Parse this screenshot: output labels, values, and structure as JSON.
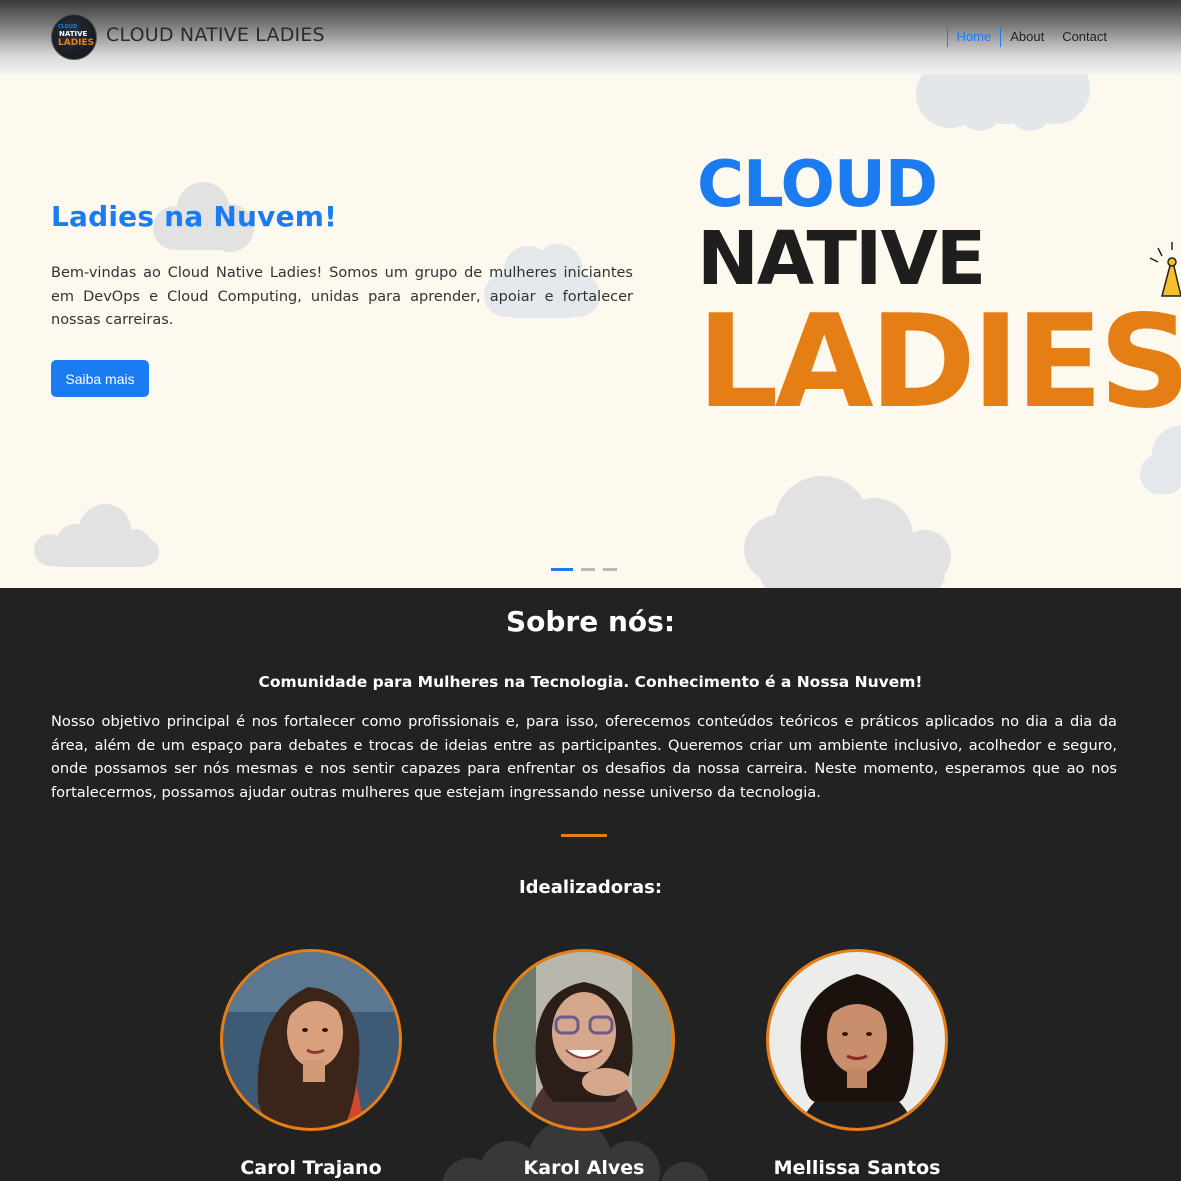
{
  "navbar": {
    "brand_name": "CLOUD NATIVE LADIES",
    "logo_text": [
      "CLOUD",
      "NATIVE",
      "LADIES"
    ],
    "links": [
      {
        "label": "Home",
        "active": true
      },
      {
        "label": "About",
        "active": false
      },
      {
        "label": "Contact",
        "active": false
      }
    ]
  },
  "hero": {
    "title": "Ladies na Nuvem!",
    "text": "Bem-vindas ao Cloud Native Ladies! Somos um grupo de mulheres iniciantes em DevOps e Cloud Computing, unidas para aprender, apoiar e fortalecer nossas carreiras.",
    "button_label": "Saiba mais",
    "banner_words": [
      "CLOUD",
      "NATIVE",
      "LADIES"
    ],
    "carousel": {
      "slides": 3,
      "active": 1
    }
  },
  "about": {
    "title": "Sobre nós:",
    "subtitle": "Comunidade para Mulheres na Tecnologia. Conhecimento é a Nossa Nuvem!",
    "text": "Nosso objetivo principal é nos fortalecer como profissionais e, para isso, oferecemos conteúdos teóricos e práticos aplicados no dia a dia da área, além de um espaço para debates e trocas de ideias entre as participantes. Queremos criar um ambiente inclusivo, acolhedor e seguro, onde possamos ser nós mesmas e nos sentir capazes para enfrentar os desafios da nossa carreira. Neste momento, esperamos que ao nos fortalecermos, possamos ajudar outras mulheres que estejam ingressando nesse universo da tecnologia.",
    "team_title": "Idealizadoras:",
    "members": [
      {
        "name": "Carol Trajano"
      },
      {
        "name": "Karol Alves"
      },
      {
        "name": "Mellissa Santos"
      }
    ]
  },
  "colors": {
    "accent_blue": "#1a7cf0",
    "accent_orange": "#e67e16",
    "hero_bg": "#fdf9ee",
    "dark_bg": "#222222"
  }
}
